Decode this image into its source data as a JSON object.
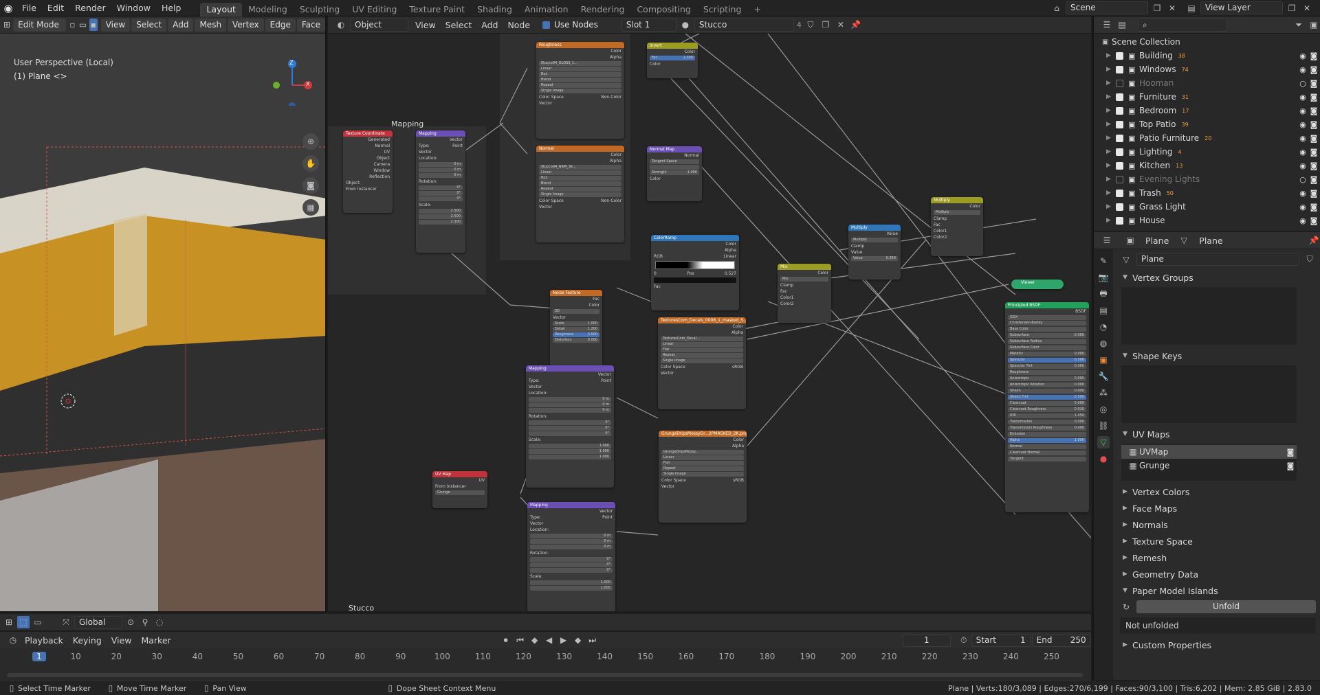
{
  "topbar": {
    "menu": [
      "File",
      "Edit",
      "Render",
      "Window",
      "Help"
    ],
    "workspaces": [
      "Layout",
      "Modeling",
      "Sculpting",
      "UV Editing",
      "Texture Paint",
      "Shading",
      "Animation",
      "Rendering",
      "Compositing",
      "Scripting"
    ],
    "active_workspace": "Layout",
    "add_tab": "+",
    "scene": "Scene",
    "view_layer": "View Layer"
  },
  "viewport": {
    "mode": "Edit Mode",
    "menus": [
      "View",
      "Select",
      "Add",
      "Mesh",
      "Vertex",
      "Edge",
      "Face"
    ],
    "transform": "Global",
    "perspective": "User Perspective (Local)",
    "object": "(1) Plane <>",
    "gizmo": {
      "z": "Z",
      "x": "X",
      "y": "Y"
    }
  },
  "node_editor": {
    "type": "Object",
    "menus": [
      "View",
      "Select",
      "Add",
      "Node"
    ],
    "use_nodes": "Use Nodes",
    "slot": "Slot 1",
    "material": "Stucco",
    "users": "4",
    "frame_label": "Mapping",
    "bottom_label": "Stucco",
    "nodes": {
      "texcoord": {
        "title": "Texture Coordinate",
        "rows": [
          "Generated",
          "Normal",
          "UV",
          "Object",
          "Camera",
          "Window",
          "Reflection"
        ],
        "object_label": "Object:",
        "from_instancer": "From Instancer"
      },
      "mapping1": {
        "title": "Mapping",
        "out": "Vector",
        "type_label": "Type:",
        "type_value": "Point",
        "vector": "Vector",
        "location": "Location:",
        "rotation": "Rotation:",
        "scale": "Scale:",
        "loc": [
          "0 m",
          "0 m",
          "0 m"
        ],
        "rot": [
          "0°",
          "0°",
          "0°"
        ],
        "scl": [
          "2.500",
          "2.500",
          "2.500"
        ]
      },
      "roughness": {
        "title": "Roughness",
        "out1": "Color",
        "out2": "Alpha",
        "image": "Stucco04_GLOSS_1...",
        "opts": [
          "Linear",
          "Box",
          "Blend",
          "Repeat",
          "Single Image"
        ],
        "blend": "0.000",
        "cs_label": "Color Space",
        "cs_value": "Non-Color",
        "vector": "Vector"
      },
      "normal": {
        "title": "Normal",
        "out1": "Color",
        "out2": "Alpha",
        "image": "Stucco04_NRM_3K...",
        "opts": [
          "Linear",
          "Box",
          "Blend",
          "Repeat",
          "Single Image"
        ],
        "blend": "0.000",
        "cs_label": "Color Space",
        "cs_value": "Non-Color",
        "vector": "Vector"
      },
      "invert": {
        "title": "Invert",
        "out": "Color",
        "fac_label": "Fac",
        "fac": "1.000",
        "color": "Color"
      },
      "normalmap": {
        "title": "Normal Map",
        "out": "Normal",
        "space": "Tangent Space",
        "strength_label": "Strength",
        "strength": "1.000",
        "color": "Color"
      },
      "colorramp": {
        "title": "ColorRamp",
        "out1": "Color",
        "out2": "Alpha",
        "mode": "RGB",
        "interp": "Linear",
        "stop": "0",
        "pos_label": "Pos",
        "pos": "0.527",
        "fac": "Fac"
      },
      "noise": {
        "title": "Noise Texture",
        "out1": "Fac",
        "out2": "Color",
        "dim": "3D",
        "vector": "Vector",
        "rows": [
          {
            "k": "Scale",
            "v": "1.000"
          },
          {
            "k": "Detail",
            "v": "1.200"
          },
          {
            "k": "Roughness",
            "v": "0.500"
          },
          {
            "k": "Distortion",
            "v": "0.000"
          }
        ]
      },
      "mix": {
        "title": "Mix",
        "out": "Color",
        "blend": "Mix",
        "clamp": "Clamp",
        "fac": "Fac",
        "c1": "Color1",
        "c2": "Color2"
      },
      "multiply1": {
        "title": "Multiply",
        "out": "Value",
        "op": "Multiply",
        "clamp": "Clamp",
        "value": "Value",
        "value2_label": "Value",
        "value2": "0.350"
      },
      "multiply2": {
        "title": "Multiply",
        "out": "Color",
        "op": "Multiply",
        "clamp": "Clamp",
        "fac": "Fac",
        "c1": "Color1",
        "c2": "Color2"
      },
      "texcom": {
        "title": "TexturesCom_Decals_0008_1_masked_S...",
        "out1": "Color",
        "out2": "Alpha",
        "image": "TexturesCom_Decal...",
        "opts": [
          "Linear",
          "Flat",
          "Repeat",
          "Single Image"
        ],
        "cs_label": "Color Space",
        "cs_value": "sRGB",
        "vector": "Vector"
      },
      "grunge": {
        "title": "GrungeDripsMossyGr...2PMASKED_2K.png",
        "out1": "Color",
        "out2": "Alpha",
        "image": "GrungeDripsMossy...",
        "opts": [
          "Linear",
          "Flat",
          "Repeat",
          "Single Image"
        ],
        "cs_label": "Color Space",
        "cs_value": "sRGB",
        "vector": "Vector"
      },
      "uvmap": {
        "title": "UV Map",
        "out": "UV",
        "from_instancer": "From Instancer",
        "map": "Grunge"
      },
      "mapping2": {
        "title": "Mapping",
        "out": "Vector",
        "type_label": "Type:",
        "type_value": "Point",
        "vector": "Vector",
        "location": "Location:",
        "rotation": "Rotation:",
        "scale": "Scale:",
        "loc": [
          "0 m",
          "0 m",
          "0 m"
        ],
        "rot": [
          "0°",
          "0°",
          "0°"
        ],
        "scl": [
          "1.000",
          "1.000",
          "1.000"
        ]
      },
      "mapping3": {
        "title": "Mapping",
        "out": "Vector",
        "type_label": "Type:",
        "type_value": "Point",
        "vector": "Vector",
        "location": "Location:",
        "rotation": "Rotation:",
        "scale": "Scale:",
        "loc": [
          "0 m",
          "0 m",
          "0 m"
        ],
        "rot": [
          "0°",
          "0°",
          "0°"
        ],
        "scl": [
          "1.000",
          "1.000",
          "1.000"
        ]
      },
      "viewer": {
        "title": "Viewer"
      },
      "bsdf": {
        "title": "Principled BSDF",
        "out": "BSDF",
        "dist": "GGX",
        "sss": "Christensen-Burley",
        "rows": [
          {
            "k": "Base Color",
            "v": ""
          },
          {
            "k": "Subsurface",
            "v": "0.000"
          },
          {
            "k": "Subsurface Radius",
            "v": ""
          },
          {
            "k": "Subsurface Color",
            "v": ""
          },
          {
            "k": "Metallic",
            "v": "0.000"
          },
          {
            "k": "Specular",
            "v": "0.500"
          },
          {
            "k": "Specular Tint",
            "v": "0.000"
          },
          {
            "k": "Roughness",
            "v": ""
          },
          {
            "k": "Anisotropic",
            "v": "0.000"
          },
          {
            "k": "Anisotropic Rotation",
            "v": "0.000"
          },
          {
            "k": "Sheen",
            "v": "0.000"
          },
          {
            "k": "Sheen Tint",
            "v": "0.500"
          },
          {
            "k": "Clearcoat",
            "v": "0.000"
          },
          {
            "k": "Clearcoat Roughness",
            "v": "0.030"
          },
          {
            "k": "IOR",
            "v": "1.450"
          },
          {
            "k": "Transmission",
            "v": "0.000"
          },
          {
            "k": "Transmission Roughness",
            "v": "0.000"
          },
          {
            "k": "Emission",
            "v": ""
          },
          {
            "k": "Alpha",
            "v": "1.000"
          },
          {
            "k": "Normal",
            "v": ""
          },
          {
            "k": "Clearcoat Normal",
            "v": ""
          },
          {
            "k": "Tangent",
            "v": ""
          }
        ]
      }
    }
  },
  "outliner": {
    "title": "Scene Collection",
    "items": [
      {
        "name": "Building",
        "badge": "38",
        "on": true
      },
      {
        "name": "Windows",
        "badge": "74",
        "on": true
      },
      {
        "name": "Hooman",
        "badge": "",
        "on": false
      },
      {
        "name": "Furniture",
        "badge": "31",
        "on": true
      },
      {
        "name": "Bedroom",
        "badge": "17",
        "on": true
      },
      {
        "name": "Top Patio",
        "badge": "39",
        "on": true
      },
      {
        "name": "Patio Furniture",
        "badge": "20",
        "on": true
      },
      {
        "name": "Lighting",
        "badge": "4",
        "on": true
      },
      {
        "name": "Kitchen",
        "badge": "13",
        "on": true
      },
      {
        "name": "Evening Lights",
        "badge": "",
        "on": false
      },
      {
        "name": "Trash",
        "badge": "50",
        "on": true
      },
      {
        "name": "Grass Light",
        "badge": "",
        "on": true
      },
      {
        "name": "House",
        "badge": "",
        "on": true
      }
    ]
  },
  "properties": {
    "object": "Plane",
    "data": "Plane",
    "mesh_name": "Plane",
    "vertex_groups": "Vertex Groups",
    "shape_keys": "Shape Keys",
    "uv_maps": "UV Maps",
    "uv_list": [
      "UVMap",
      "Grunge"
    ],
    "sections": [
      "Vertex Colors",
      "Face Maps",
      "Normals",
      "Texture Space",
      "Remesh",
      "Geometry Data"
    ],
    "paper_model": "Paper Model Islands",
    "unfold": "Unfold",
    "not_unfolded": "Not unfolded",
    "custom_props": "Custom Properties"
  },
  "timeline": {
    "menus": [
      "Playback",
      "Keying",
      "View",
      "Marker"
    ],
    "current_frame": "1",
    "start_label": "Start",
    "start": "1",
    "end_label": "End",
    "end": "250",
    "ticks": [
      "1",
      "10",
      "20",
      "30",
      "40",
      "50",
      "60",
      "70",
      "80",
      "90",
      "100",
      "110",
      "120",
      "130",
      "140",
      "150",
      "160",
      "170",
      "180",
      "190",
      "200",
      "210",
      "220",
      "230",
      "240",
      "250"
    ]
  },
  "statusbar": {
    "hints": [
      "Select Time Marker",
      "Move Time Marker",
      "Pan View",
      "Dope Sheet Context Menu"
    ],
    "stats": "Plane | Verts:180/3,089 | Edges:270/6,199 | Faces:90/3,100 | Tris:6,202 | Mem: 2.85 GiB | 2.83.0"
  },
  "colors": {
    "accent": "#4772b3",
    "header_image": "#c06a26",
    "header_vector": "#6b4fb5",
    "header_input": "#c2323a",
    "header_color": "#9c9c22",
    "header_converter": "#2f77b8",
    "header_shader": "#23a05b",
    "viewer": "#2ea56a"
  }
}
